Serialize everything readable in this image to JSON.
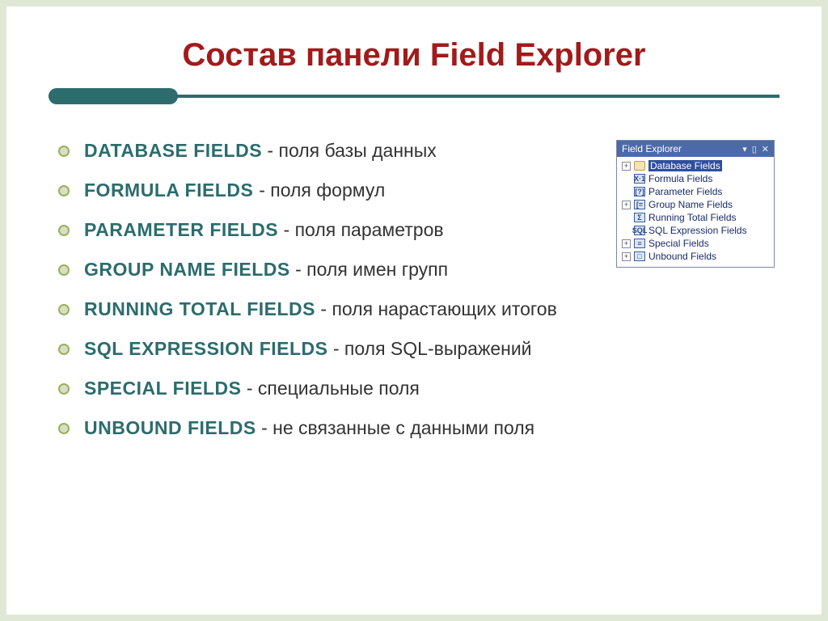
{
  "title": "Состав панели Field Explorer",
  "items": [
    {
      "term": "DATABASE FIELDS",
      "desc": " - поля базы данных"
    },
    {
      "term": "FORMULA FIELDS ",
      "desc": " - поля формул"
    },
    {
      "term": "PARAMETER FIELDS",
      "desc": " - поля параметров"
    },
    {
      "term": "GROUP NAME FIELDS",
      "desc": " - поля имен групп"
    },
    {
      "term": "RUNNING TOTAL FIELDS",
      "desc": " - поля нарастающих итогов"
    },
    {
      "term": "SQL EXPRESSION FIELDS",
      "desc": " - поля SQL-выражений"
    },
    {
      "term": "SPECIAL FIELDS",
      "desc": " - специальные поля"
    },
    {
      "term": "UNBOUND FIELDS",
      "desc": " - не связанные с данными поля"
    }
  ],
  "panel": {
    "title": "Field Explorer",
    "glyphs": {
      "dropdown": "▾",
      "pin": "▯",
      "close": "✕"
    },
    "nodes": [
      {
        "expander": "+",
        "icon": "db",
        "iconText": "",
        "label": "Database Fields",
        "selected": true
      },
      {
        "expander": "",
        "icon": "fx",
        "iconText": "X·1",
        "label": "Formula Fields",
        "selected": false
      },
      {
        "expander": "",
        "icon": "pm",
        "iconText": "[?]",
        "label": "Parameter Fields",
        "selected": false
      },
      {
        "expander": "+",
        "icon": "gr",
        "iconText": "[=",
        "label": "Group Name Fields",
        "selected": false
      },
      {
        "expander": "",
        "icon": "rt",
        "iconText": "Σ",
        "label": "Running Total Fields",
        "selected": false
      },
      {
        "expander": "",
        "icon": "sq",
        "iconText": "SQL",
        "label": "SQL Expression Fields",
        "selected": false
      },
      {
        "expander": "+",
        "icon": "sp",
        "iconText": "≡",
        "label": "Special Fields",
        "selected": false
      },
      {
        "expander": "+",
        "icon": "ub",
        "iconText": "□",
        "label": "Unbound Fields",
        "selected": false
      }
    ]
  }
}
